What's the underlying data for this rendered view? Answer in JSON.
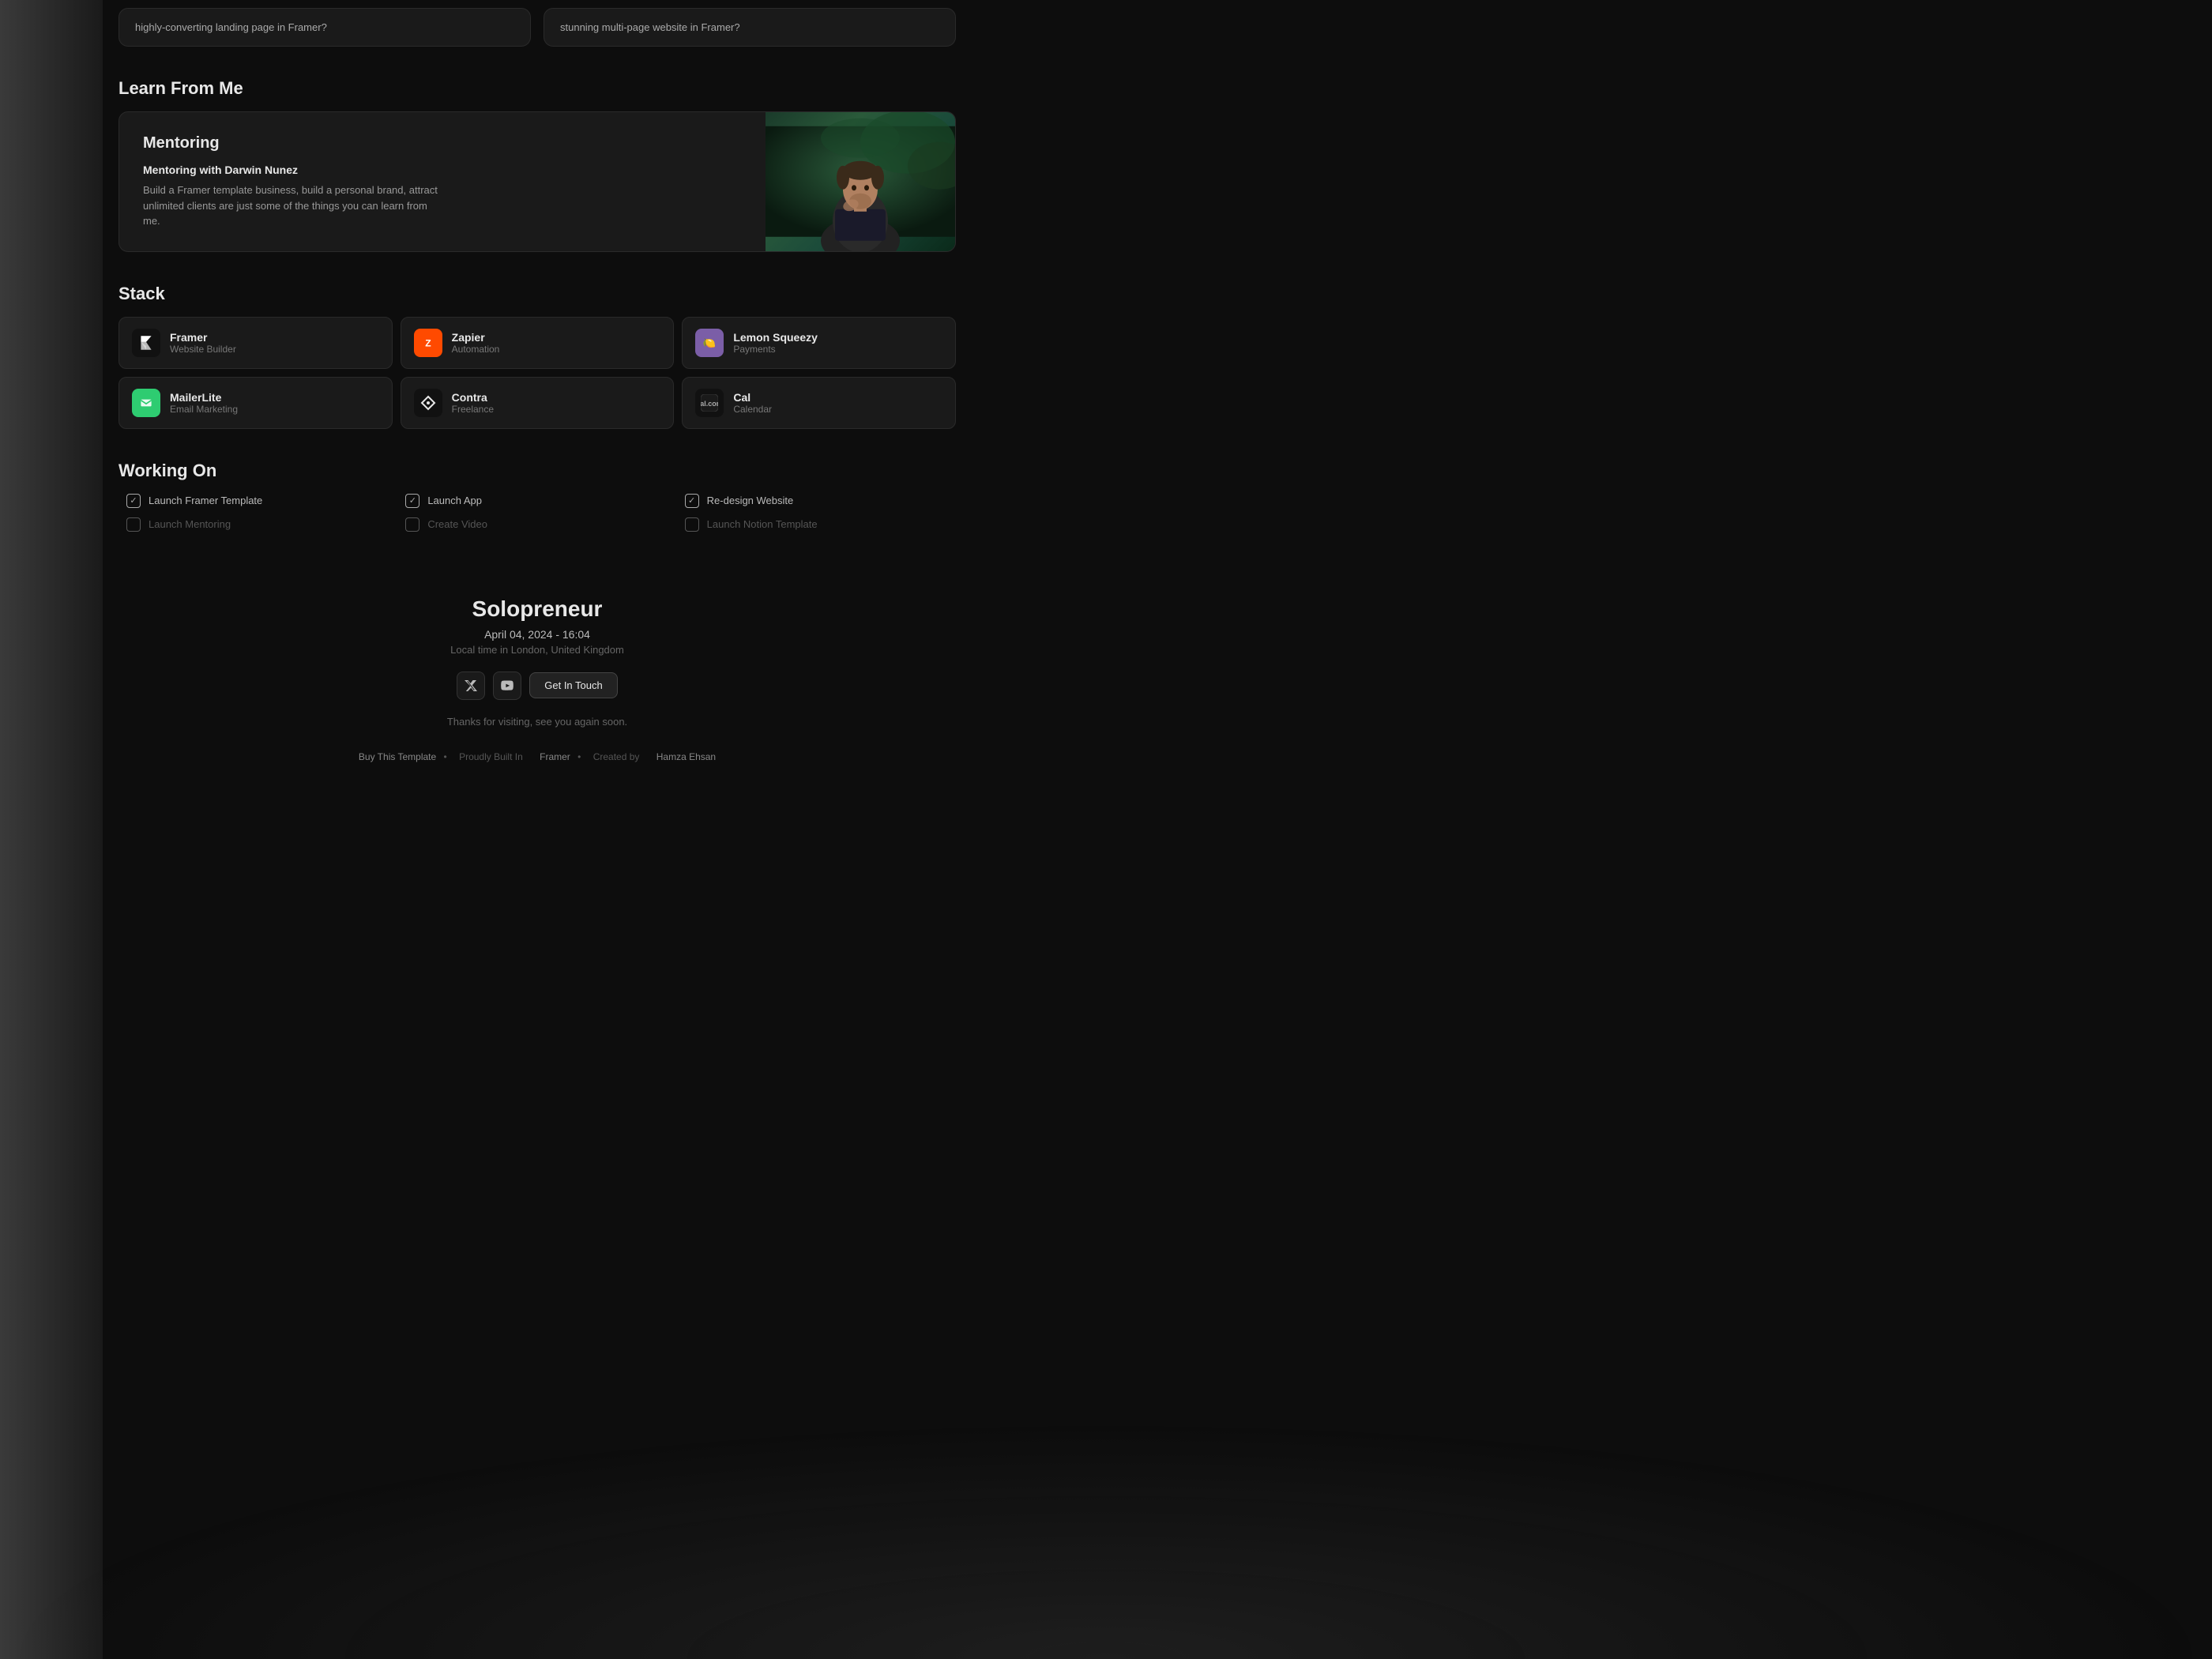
{
  "top_cards": [
    {
      "text": "highly-converting landing page in Framer?"
    },
    {
      "text": "stunning multi-page website in Framer?"
    }
  ],
  "learn_section": {
    "title": "Learn From Me",
    "card": {
      "title": "Mentoring",
      "subtitle": "Mentoring with Darwin Nunez",
      "description": "Build a Framer template business, build a personal brand, attract unlimited clients are just some of the things you can learn from me."
    }
  },
  "stack_section": {
    "title": "Stack",
    "items": [
      {
        "name": "Framer",
        "desc": "Website Builder",
        "icon_type": "framer"
      },
      {
        "name": "Zapier",
        "desc": "Automation",
        "icon_type": "zapier"
      },
      {
        "name": "Lemon Squeezy",
        "desc": "Payments",
        "icon_type": "lemon"
      },
      {
        "name": "MailerLite",
        "desc": "Email Marketing",
        "icon_type": "mailerlite"
      },
      {
        "name": "Contra",
        "desc": "Freelance",
        "icon_type": "contra"
      },
      {
        "name": "Cal",
        "desc": "Calendar",
        "icon_type": "cal"
      }
    ]
  },
  "working_section": {
    "title": "Working On",
    "columns": [
      {
        "items": [
          {
            "label": "Launch Framer Template",
            "done": true
          },
          {
            "label": "Launch Mentoring",
            "done": false
          }
        ]
      },
      {
        "items": [
          {
            "label": "Launch App",
            "done": true
          },
          {
            "label": "Create Video",
            "done": false
          }
        ]
      },
      {
        "items": [
          {
            "label": "Re-design Website",
            "done": true
          },
          {
            "label": "Launch Notion Template",
            "done": false
          }
        ]
      }
    ]
  },
  "footer": {
    "name": "Solopreneur",
    "date": "April 04, 2024 - 16:04",
    "location": "Local time in London, United Kingdom",
    "social_x_label": "𝕏",
    "social_yt_label": "▶",
    "contact_label": "Get In Touch",
    "thanks": "Thanks for visiting, see you again soon.",
    "buy_label": "Buy This Template",
    "built_label": "Proudly Built In",
    "built_link": "Framer",
    "created_label": "Created by",
    "created_name": "Hamza Ehsan"
  }
}
